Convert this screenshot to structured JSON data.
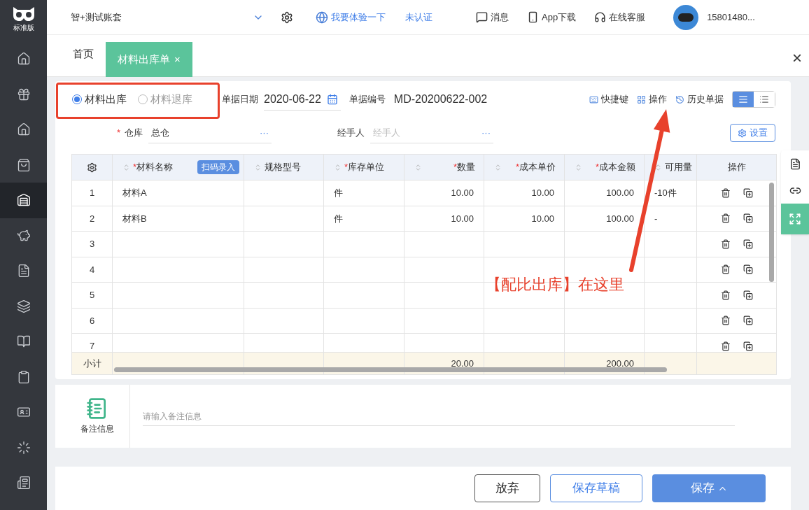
{
  "sidebar": {
    "logo_label": "标准版",
    "items": [
      {
        "selected": false
      },
      {
        "selected": false
      },
      {
        "selected": false
      },
      {
        "selected": false
      },
      {
        "selected": true
      },
      {
        "selected": false
      },
      {
        "selected": false
      },
      {
        "selected": false
      },
      {
        "selected": false
      },
      {
        "selected": false
      },
      {
        "selected": false
      },
      {
        "selected": false
      },
      {
        "selected": false
      }
    ]
  },
  "top_bar": {
    "account": "智+测试账套",
    "links": [
      "我要体验一下",
      "未认证"
    ],
    "actions": [
      "消息",
      "App下载",
      "在线客服"
    ],
    "user": "15801480..."
  },
  "tabs": [
    {
      "label": "首页",
      "selected": false,
      "closable": false
    },
    {
      "label": "材料出库单",
      "selected": true,
      "closable": true
    }
  ],
  "tab_close": "×",
  "window_close": "×",
  "required_mark": "*",
  "form": {
    "types": [
      {
        "label": "材料出库",
        "selected": true
      },
      {
        "label": "材料退库",
        "selected": false
      }
    ],
    "date_label": "单据日期",
    "date": "2020-06-22",
    "number_label": "单据编号",
    "number": "MD-20200622-002",
    "toolbar": [
      "快捷键",
      "操作",
      "历史单据"
    ],
    "views": [
      {
        "selected": true
      },
      {
        "selected": false
      }
    ],
    "fields": [
      {
        "label": "仓库",
        "required": true,
        "value": "总仓",
        "more": "···"
      },
      {
        "label": "经手人",
        "required": false,
        "placeholder": "经手人",
        "more": "···"
      }
    ],
    "settings": "设置"
  },
  "table": {
    "scan_button": "扫码录入",
    "columns": [
      {
        "label": "材料名称",
        "required": true
      },
      {
        "label": "规格型号",
        "required": false
      },
      {
        "label": "库存单位",
        "required": true
      },
      {
        "label": "数量",
        "required": true
      },
      {
        "label": "成本单价",
        "required": true
      },
      {
        "label": "成本金额",
        "required": true
      },
      {
        "label": "可用量",
        "required": false
      }
    ],
    "ops_label": "操作",
    "rows": [
      {
        "index": "1",
        "cells": [
          "材料A",
          "",
          "件",
          "10.00",
          "10.00",
          "100.00",
          "-10件"
        ]
      },
      {
        "index": "2",
        "cells": [
          "材料B",
          "",
          "件",
          "10.00",
          "10.00",
          "100.00",
          "-"
        ]
      },
      {
        "index": "3",
        "cells": [
          "",
          "",
          "",
          "",
          "",
          "",
          ""
        ]
      },
      {
        "index": "4",
        "cells": [
          "",
          "",
          "",
          "",
          "",
          "",
          ""
        ]
      },
      {
        "index": "5",
        "cells": [
          "",
          "",
          "",
          "",
          "",
          "",
          ""
        ]
      },
      {
        "index": "6",
        "cells": [
          "",
          "",
          "",
          "",
          "",
          "",
          ""
        ]
      },
      {
        "index": "7",
        "cells": [
          "",
          "",
          "",
          "",
          "",
          "",
          ""
        ]
      }
    ],
    "subtotal": {
      "label": "小计",
      "cells": [
        "",
        "",
        "",
        "20.00",
        "",
        "200.00",
        ""
      ]
    }
  },
  "remarks": {
    "label": "备注信息",
    "placeholder": "请输入备注信息"
  },
  "footer": {
    "buttons": [
      {
        "label": "放弃",
        "kind": "plain"
      },
      {
        "label": "保存草稿",
        "kind": "outline"
      },
      {
        "label": "保存",
        "kind": "primary"
      }
    ]
  },
  "annotation": {
    "text": "【配比出库】在这里"
  }
}
